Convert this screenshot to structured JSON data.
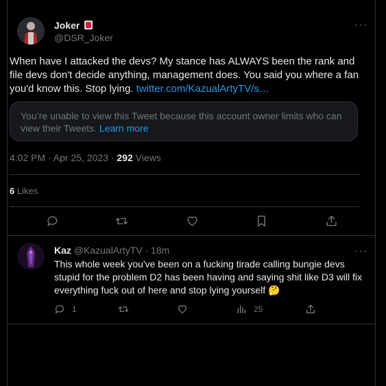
{
  "main_tweet": {
    "author_name": "Joker",
    "author_handle": "@DSR_Joker",
    "text": "When have I attacked the devs? My stance has ALWAYS been the rank and file devs don't decide anything, management does. You said you where a fan you'd know this. Stop lying. ",
    "link": "twitter.com/KazualArtyTV/s…",
    "quoted_notice": "You’re unable to view this Tweet because this account owner limits who can view their Tweets. ",
    "learn_more": "Learn more",
    "time": "4:02 PM · Apr 25, 2023 · ",
    "views_count": "292",
    "views_label": " Views",
    "likes_count": "6",
    "likes_label": " Likes"
  },
  "reply": {
    "author_name": "Kaz",
    "author_handle": "@KazualArtyTV · 18m",
    "text": "This whole week you've been on a fucking tirade calling bungie devs stupid for the problem D2 has been having and saying shit like D3 will fix everything fuck out of here and stop lying yourself 🤔",
    "reply_count": "1",
    "views_count": "25"
  },
  "icons": {
    "more": "more-icon",
    "reply": "reply-icon",
    "retweet": "retweet-icon",
    "like": "heart-icon",
    "bookmark": "bookmark-icon",
    "share": "share-icon",
    "views": "views-icon"
  },
  "colors": {
    "background": "#000000",
    "text": "#e7e9ea",
    "secondary": "#71767b",
    "link": "#1d9bf0",
    "border": "#2f3336"
  }
}
